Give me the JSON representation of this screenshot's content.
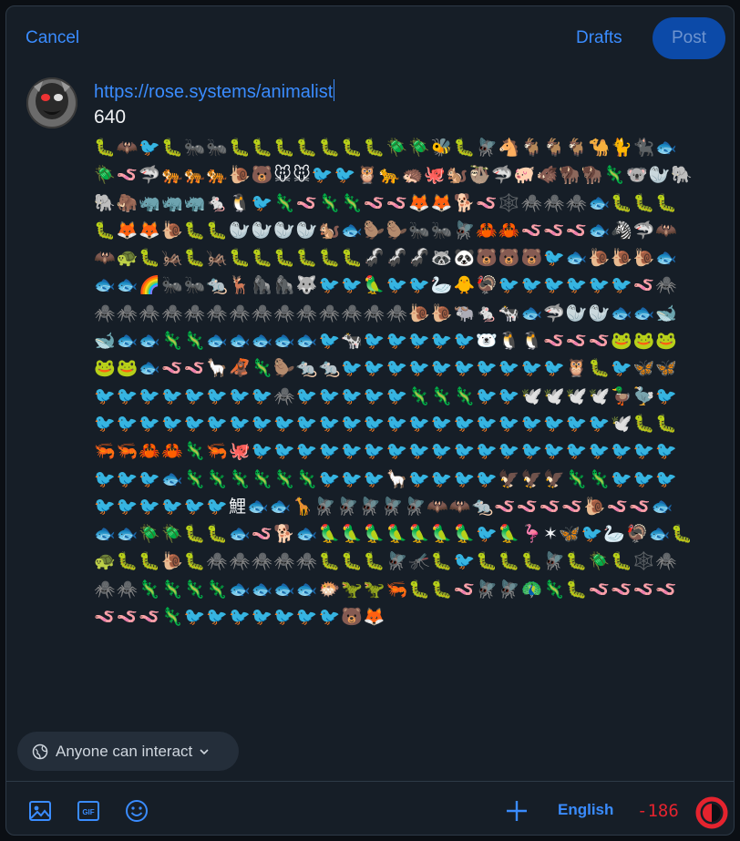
{
  "header": {
    "cancel_label": "Cancel",
    "drafts_label": "Drafts",
    "post_label": "Post"
  },
  "compose": {
    "url": "https://rose.systems/animalist",
    "number": "640",
    "emoji_text": "🐛🦇🐦🐛🐜🐜🐛🐛🐛🐛🐛🐛🐛🪲🪲🐝🐛🪰🐴🐐🐐🐐🐪🐈🐈‍⬛🐟🪲🪱🦈🐅🐅🐅🐌🐻🐭🐭🐦🐦🦉🐆🦔🐙🐿️🦥🦈🐖🐗🦬🦬🦎🐨🦭🐘🐘🦣🦏🦏🦏🐁🐧🐦🦎🪱🦎🦎🪱🪱🦊🦊🐕🪱🕸️🕷️🕷️🕷️🐟🐛🐛🐛🐛🦊🦊🐌🐛🐛🦭🦭🦭🦭🐿️🐟🦫🦫🐜🐜🪰🦀🦀🪱🪱🪱🐟🦓🦈🦇🦇🐢🐛🦗🐛🦗🐛🐛🐛🐛🐛🐛🦨🦨🦨🦝🐼🐻🐻🐻🐦🐟🐌🐌🐌🐟🐟🐟🌈🐜🐜🐀🦌🦍🦍🐺🐦🐦🦜🐦🐦🦢🐥🦃🐦🐦🐦🐦🐦🐦🪱🕷️🕷️🕷️🕷️🕷️🕷️🕷️🕷️🕷️🕷️🕷️🕷️🕷️🕷️🕷️🐌🐌🐃🐁🐄🐟🦈🦭🦭🐟🐟🐋🐋🐟🐟🦎🦎🐟🐟🐟🐟🐟🐦🐄🐦🐦🐦🐦🐦🐻‍❄️🐧🐧🪱🪱🪱🐸🐸🐸🐸🐸🐟🪱🪱🦙🦧🦎🦫🐀🐀🐦🐦🐦🐦🐦🐦🐦🐦🐦🐦🦉🐛🐦🦋🦋🐦🐦🐦🐦🐦🐦🐦🐦🕷️🐦🐦🐦🐦🐦🦎🦎🦎🐦🐦🕊️🕊️🕊️🕊️🦆🦤🐦🐦🐦🐦🐦🐦🐦🐦🐦🐦🐦🐦🐦🐦🐦🐦🐦🐦🐦🐦🐦🐦🐦🐦🕊️🐛🐛🦐🦐🦀🦀🦎🦐🐙🐦🐦🐦🐦🐦🐦🐦🐦🐦🐦🐦🐦🐦🐦🐦🐦🐦🐦🐦🐦🐦🐦🐟🦎🦎🦎🦎🦎🦎🐦🐦🐦🦙🐦🐦🐦🐦🦅🦅🦅🦎🦎🐦🐦🐦🐦🐦🐦🐦🐦🐦鯉🐟🐟🦒🪰🪰🪰🪰🪰🦇🦇🐀🪱🪱🪱🪱🐌🪱🪱🐟🐟🐟🪲🪲🐛🐛🐟🪱🐕🐟🦜🦜🦜🦜🦜🦜🦜🐦🦜🦩✶🦋🐦🦢🦃🐟🐛🐢🐛🐛🐌🐛🕷️🕷️🕷️🕷️🕷️🐛🐛🐛🪰🦟🐛🐦🐛🐛🐛🪰🐛🪲🐛🕸️🕷️🕷️🕷️🦎🦎🦎🦎🐟🐟🐟🐟🐡🦖🦖🦐🐛🐛🪱🪰🪰🦚🦎🐛🪱🪱🪱🪱🪱🪱🪱🦎🐦🐦🐦🐦🐦🐦🐦🐻🦊"
  },
  "controls": {
    "interact_label": "Anyone can interact",
    "language_label": "English",
    "char_count": "-186",
    "char_progress": 1.0
  },
  "colors": {
    "accent": "#3a8cff",
    "post_bg": "#0c4aa8",
    "over_limit": "#e5232e",
    "background": "#161e27"
  }
}
